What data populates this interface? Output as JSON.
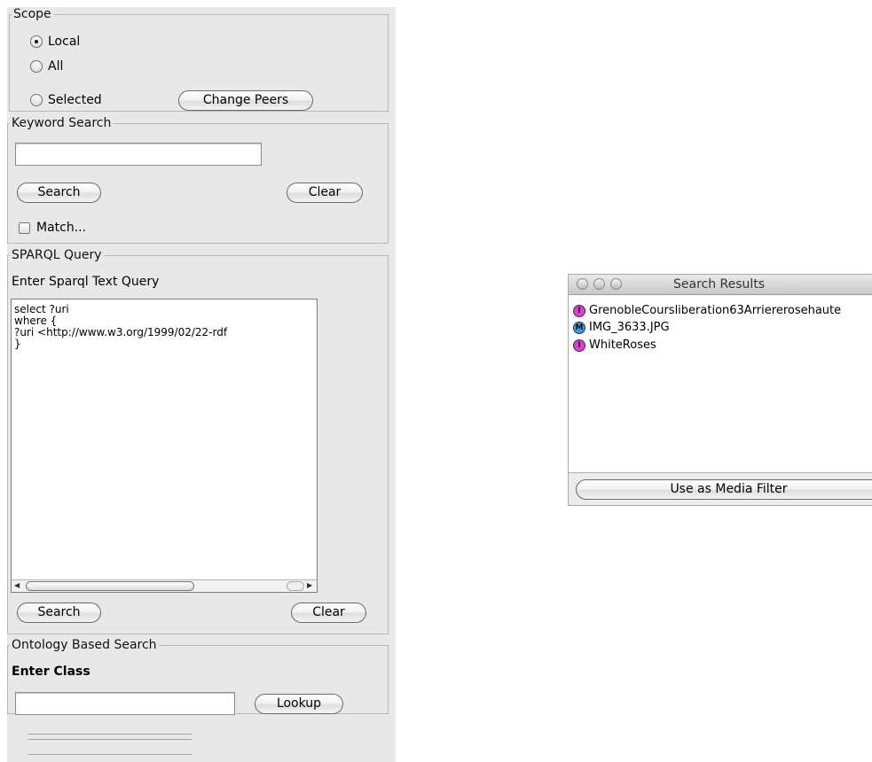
{
  "scope": {
    "legend": "Scope",
    "options": [
      "Local",
      "All",
      "Selected"
    ],
    "selected": "Local",
    "change_peers_label": "Change Peers"
  },
  "keyword_search": {
    "legend": "Keyword Search",
    "input_value": "",
    "search_label": "Search",
    "clear_label": "Clear",
    "match_label": "Match...",
    "match_checked": false
  },
  "sparql": {
    "legend": "SPARQL Query",
    "prompt": "Enter Sparql Text Query",
    "query_lines": [
      "select ?uri",
      "where {",
      "?uri <http://www.w3.org/1999/02/22-rdf",
      "}"
    ],
    "search_label": "Search",
    "clear_label": "Clear"
  },
  "ontology": {
    "legend": "Ontology Based Search",
    "prompt": "Enter Class",
    "input_value": "",
    "lookup_label": "Lookup"
  },
  "results_window": {
    "title": "Search Results",
    "items": [
      {
        "badge": "I",
        "name": "GrenobleCoursliberation63Arriererosehaute"
      },
      {
        "badge": "M",
        "name": "IMG_3633.JPG"
      },
      {
        "badge": "I",
        "name": "WhiteRoses"
      }
    ],
    "filter_button_label": "Use as Media Filter"
  },
  "colors": {
    "panel_bg": "#e8e8e8",
    "instance_badge": "#e33ad9",
    "media_badge": "#3a9ee6"
  }
}
